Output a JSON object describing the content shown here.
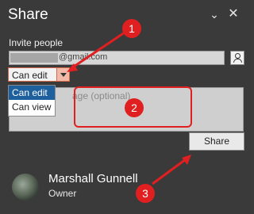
{
  "dialog": {
    "title": "Share",
    "options_icon": "chevron-down-icon",
    "close_icon": "close-icon"
  },
  "invite": {
    "label": "Invite people",
    "email_visible_text": "@gmail.com",
    "address_book_icon": "address-book-icon"
  },
  "permission": {
    "selected": "Can edit",
    "options": [
      "Can edit",
      "Can view"
    ]
  },
  "message": {
    "placeholder": "age (optional)"
  },
  "share_button": {
    "label": "Share"
  },
  "owner": {
    "name": "Marshall Gunnell",
    "role": "Owner"
  },
  "annotations": {
    "badges": [
      "1",
      "2",
      "3"
    ],
    "color": "#e02020"
  }
}
